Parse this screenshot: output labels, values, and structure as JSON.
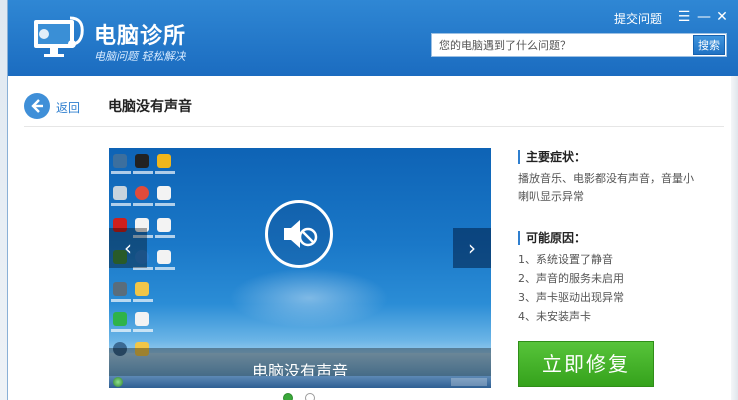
{
  "header": {
    "app_title": "电脑诊所",
    "app_subtitle": "电脑问题 轻松解决",
    "feedback_link": "提交问题",
    "menu_glyph": "☰",
    "minimize_glyph": "—",
    "close_glyph": "✕"
  },
  "search": {
    "placeholder": "您的电脑遇到了什么问题？",
    "button_label": "搜索"
  },
  "nav": {
    "back_label": "返回",
    "page_title": "电脑没有声音"
  },
  "slideshow": {
    "caption": "电脑没有声音",
    "prev_glyph": "‹",
    "next_glyph": "›",
    "slide_count": 2,
    "active_index": 0
  },
  "symptoms": {
    "heading": "主要症状：",
    "text": "播放音乐、电影都没有声音，音量小喇叭显示异常"
  },
  "causes": {
    "heading": "可能原因：",
    "items": [
      "1、系统设置了静音",
      "2、声音的服务未启用",
      "3、声卡驱动出现异常",
      "4、未安装声卡"
    ]
  },
  "actions": {
    "fix_label": "立即修复"
  },
  "colors": {
    "header_blue": "#1b6cc0",
    "accent_blue": "#2f7fcf",
    "fix_green": "#35a21c"
  }
}
